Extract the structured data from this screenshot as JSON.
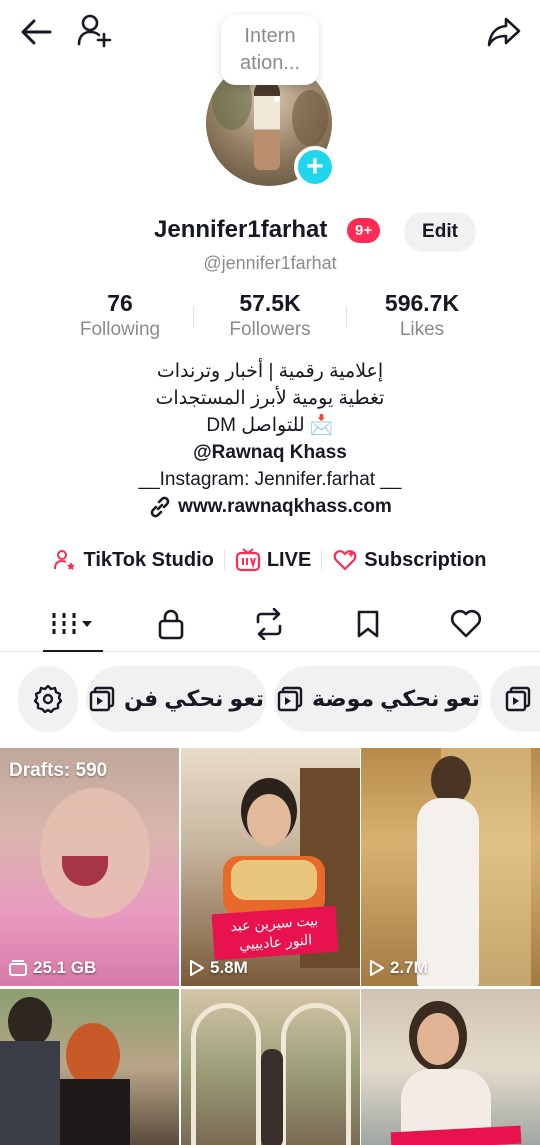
{
  "header": {
    "tooltip": "Intern ation...",
    "username": "Jennifer1farhat",
    "notifications": "9+",
    "edit_label": "Edit",
    "handle": "@jennifer1farhat"
  },
  "stats": [
    {
      "value": "76",
      "label": "Following"
    },
    {
      "value": "57.5K",
      "label": "Followers"
    },
    {
      "value": "596.7K",
      "label": "Likes"
    }
  ],
  "bio": {
    "line1": "إعلامية رقمية | أخبار وترندات",
    "line2": "تغطية يومية لأبرز المستجدات",
    "line3": "DM للتواصل 📩",
    "line4": "@Rawnaq Khass",
    "line5": "__Instagram: Jennifer.farhat __",
    "link": "www.rawnaqkhass.com"
  },
  "tools": {
    "studio": "TikTok Studio",
    "live": "LIVE",
    "subscription": "Subscription"
  },
  "chips": [
    "تعو نحكي فن",
    "تعو نحكي موضة"
  ],
  "grid": {
    "drafts": "Drafts: 590",
    "drafts_size": "25.1 GB",
    "views": [
      "5.8M",
      "2.7M"
    ],
    "caption": "بيت سيرين عبد النور عاديييي"
  },
  "colors": {
    "accent": "#fe2c55",
    "badge": "#20d5ec",
    "text": "#161823",
    "muted": "#8a8b91"
  }
}
